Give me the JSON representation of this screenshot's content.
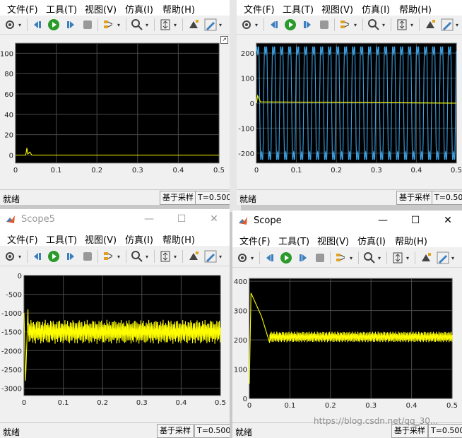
{
  "menu": {
    "file": "文件(F)",
    "tools": "工具(T)",
    "view": "视图(V)",
    "sim": "仿真(I)",
    "help": "帮助(H)"
  },
  "status": {
    "ready": "就绪",
    "sample_based": "基于采样",
    "time": "T=0.500"
  },
  "windows": {
    "tl": {
      "title": ""
    },
    "tr": {
      "title": ""
    },
    "bl": {
      "title": "Scope5"
    },
    "br": {
      "title": "Scope"
    }
  },
  "watermark": "https://blog.csdn.net/qq_30...",
  "plot_colors": {
    "bg": "#000000",
    "grid": "#4a4a4a",
    "yellow": "#ffff00",
    "blue": "#3ba3e6"
  },
  "chart_data": [
    {
      "type": "line",
      "id": "tl",
      "xlim": [
        0,
        0.5
      ],
      "ylim": [
        -8,
        110
      ],
      "xticks": [
        "0",
        "0.1",
        "0.2",
        "0.3",
        "0.4",
        "0.5"
      ],
      "yticks": [
        "100",
        "80",
        "60",
        "40",
        "20",
        "0"
      ],
      "series": [
        {
          "color": "yellow",
          "points": [
            [
              0,
              0
            ],
            [
              0.025,
              0
            ],
            [
              0.028,
              7
            ],
            [
              0.03,
              1
            ],
            [
              0.035,
              3
            ],
            [
              0.04,
              0
            ],
            [
              0.5,
              0
            ]
          ]
        }
      ]
    },
    {
      "type": "line",
      "id": "tr",
      "xlim": [
        0,
        0.5
      ],
      "ylim": [
        -240,
        240
      ],
      "xticks": [
        "0",
        "0.1",
        "0.2",
        "0.3",
        "0.4",
        "0.5"
      ],
      "yticks": [
        "200",
        "100",
        "0",
        "-100",
        "-200"
      ],
      "series": [
        {
          "color": "blue",
          "wave": {
            "freq": 50,
            "amp": 225,
            "phase": 0.6
          }
        },
        {
          "color": "yellow",
          "points": [
            [
              0,
              0
            ],
            [
              0.003,
              30
            ],
            [
              0.01,
              5
            ],
            [
              0.5,
              0
            ]
          ]
        }
      ]
    },
    {
      "type": "line",
      "id": "bl",
      "xlim": [
        0,
        0.5
      ],
      "ylim": [
        -3200,
        0
      ],
      "xticks": [
        "0",
        "0.1",
        "0.2",
        "0.3",
        "0.4",
        "0.5"
      ],
      "yticks": [
        "0",
        "-500",
        "-1000",
        "-1500",
        "-2000",
        "-2500",
        "-3000"
      ],
      "series": [
        {
          "color": "yellow",
          "center": -1500,
          "ripple": 200,
          "start": [
            [
              0,
              -1000
            ],
            [
              0.004,
              -2800
            ],
            [
              0.01,
              -900
            ]
          ]
        }
      ]
    },
    {
      "type": "line",
      "id": "br",
      "xlim": [
        0,
        0.5
      ],
      "ylim": [
        0,
        410
      ],
      "xticks": [
        "0",
        "0.1",
        "0.2",
        "0.3",
        "0.4",
        "0.5"
      ],
      "yticks": [
        "400",
        "300",
        "200",
        "100",
        "0"
      ],
      "series": [
        {
          "color": "yellow",
          "center": 210,
          "ripple": 12,
          "start": [
            [
              0,
              50
            ],
            [
              0.004,
              360
            ],
            [
              0.03,
              280
            ],
            [
              0.05,
              190
            ]
          ]
        }
      ]
    }
  ]
}
